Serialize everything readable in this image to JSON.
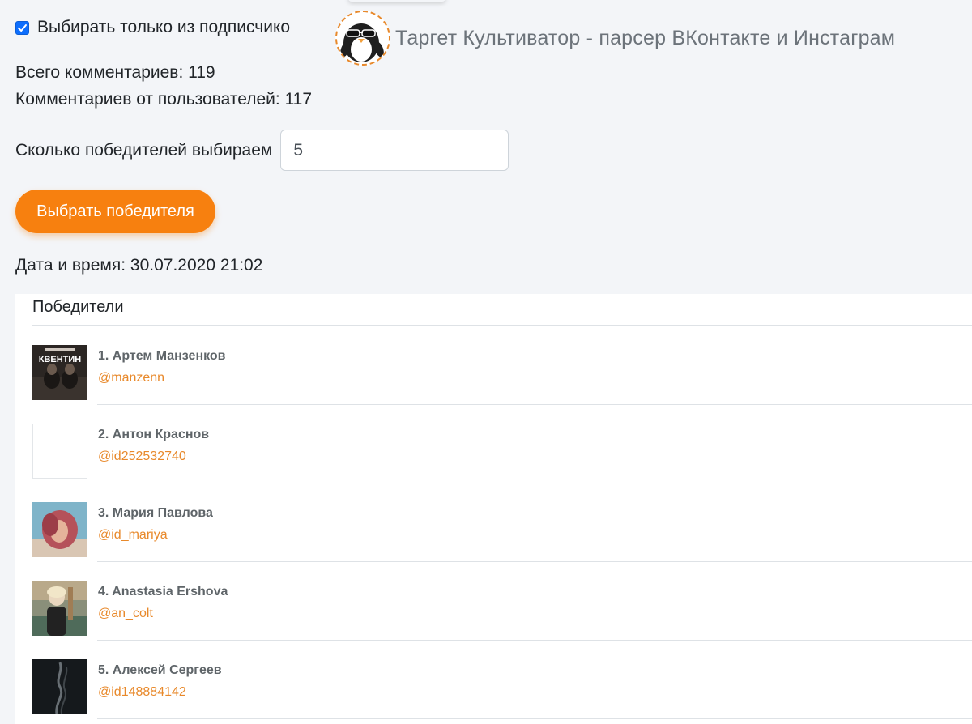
{
  "subscribers_checkbox": {
    "label": "Выбирать только из подписчико",
    "checked": true
  },
  "brand": {
    "title": "Таргет Культиватор - парсер ВКонтакте и Инстаграм",
    "logo_icon": "penguin-sunglasses-logo"
  },
  "stats": {
    "total_comments": "Всего комментариев: 119",
    "user_comments": "Комментариев от пользователей: 117"
  },
  "winners_count": {
    "label": "Сколько победителей выбираем",
    "value": "5"
  },
  "pick_button": {
    "label": "Выбрать победителя"
  },
  "datetime": "Дата и время: 30.07.2020 21:02",
  "winners": {
    "title": "Победители",
    "items": [
      {
        "name": "1. Артем Манзенков",
        "handle": "@manzenn",
        "avatar_icon": "avatar-photo-kventin",
        "avatar_text": "КВЕНТИН"
      },
      {
        "name": "2. Антон Краснов",
        "handle": "@id252532740",
        "avatar_icon": "avatar-blank"
      },
      {
        "name": "3. Мария Павлова",
        "handle": "@id_mariya",
        "avatar_icon": "avatar-photo-red-hair"
      },
      {
        "name": "4. Anastasia Ershova",
        "handle": "@an_colt",
        "avatar_icon": "avatar-photo-outdoor"
      },
      {
        "name": "5. Алексей Сергеев",
        "handle": "@id148884142",
        "avatar_icon": "avatar-photo-smoke"
      }
    ]
  },
  "colors": {
    "accent_orange": "#f7800f",
    "handle_orange": "#e8892b",
    "checkbox_blue": "#0d6efd",
    "page_background": "#f3f5f8"
  }
}
